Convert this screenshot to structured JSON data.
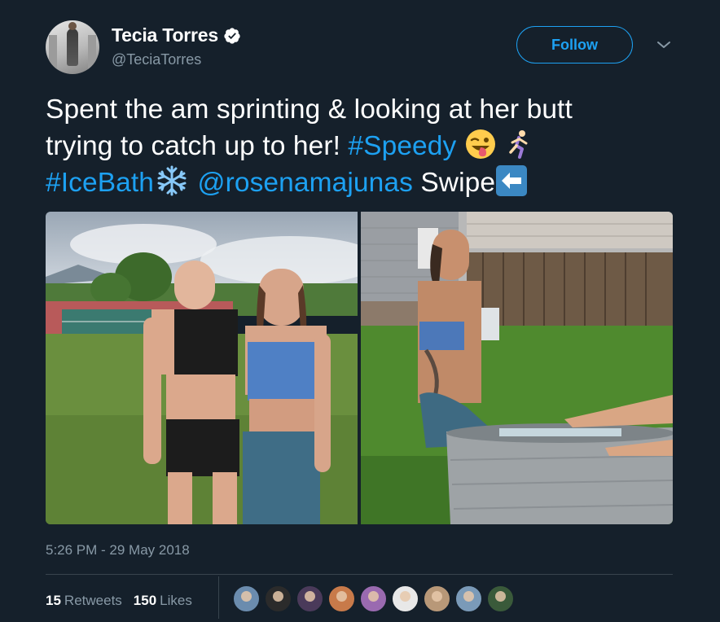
{
  "tweet": {
    "display_name": "Tecia Torres",
    "handle": "@TeciaTorres",
    "verified": true,
    "follow_label": "Follow",
    "text_parts": {
      "line1": "Spent the am sprinting & looking at her butt",
      "line2_text": "trying to catch up to her! ",
      "hashtag_speedy": "#Speedy",
      "hashtag_icebath": "#IceBath",
      "mention": "@rosenamajunas",
      "swipe": " Swipe"
    },
    "emoji": [
      "winking-face-with-tongue",
      "person-running",
      "snowflake",
      "left-arrow"
    ],
    "timestamp": "5:26 PM - 29 May 2018",
    "retweets_count": "15",
    "retweets_label": "Retweets",
    "likes_count": "150",
    "likes_label": "Likes",
    "likers": [
      "#6b8cae",
      "#2b2b2b",
      "#4a3a5a",
      "#c87a4a",
      "#9a6ab0",
      "#e8e8e8",
      "#b89878",
      "#7a9ab8",
      "#3a5a3a"
    ]
  },
  "colors": {
    "background": "#15202b",
    "accent": "#1da1f2",
    "secondary_text": "#8899a6",
    "divider": "#38444d"
  }
}
